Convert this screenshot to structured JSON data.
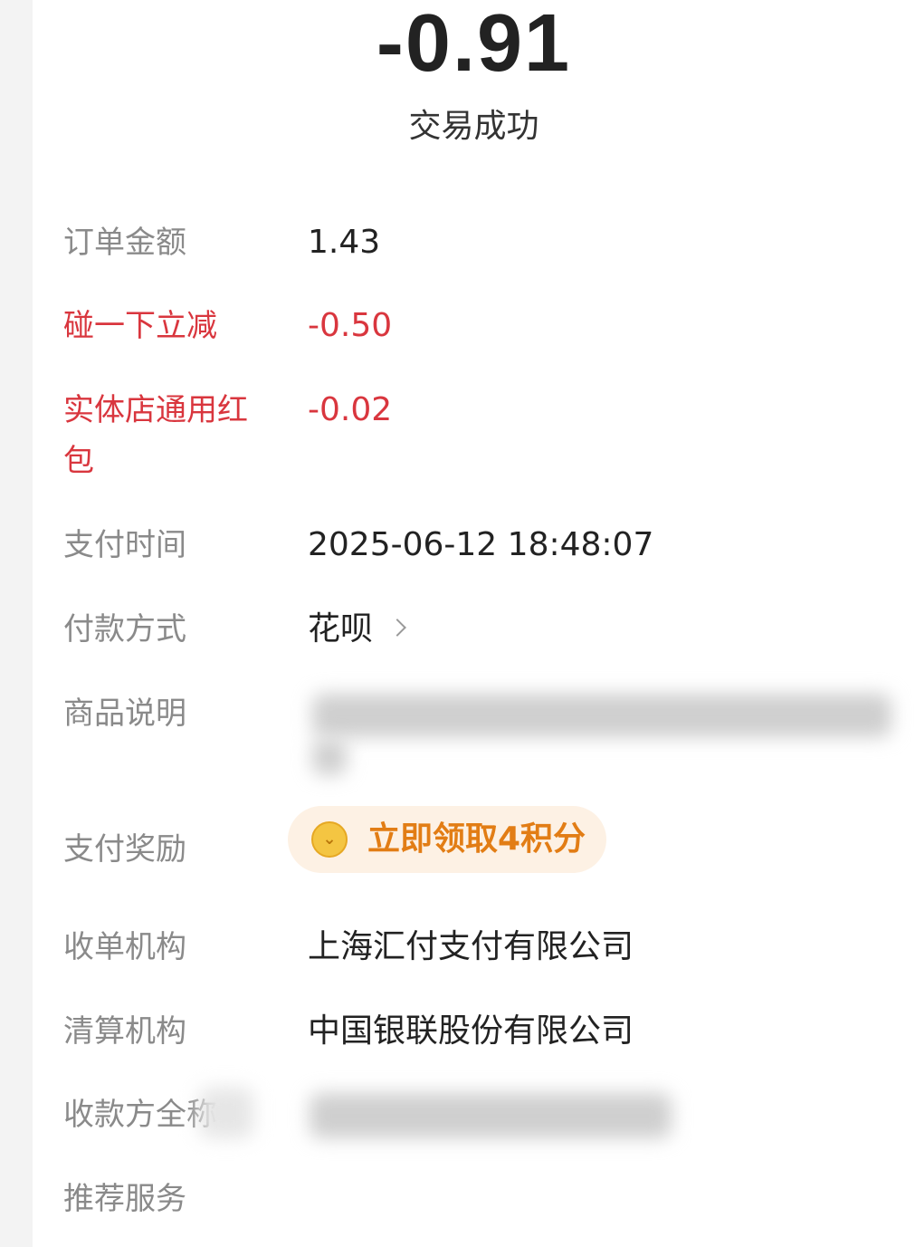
{
  "header": {
    "amount": "-0.91",
    "status": "交易成功"
  },
  "details": {
    "order_amount": {
      "label": "订单金额",
      "value": "1.43"
    },
    "tap_discount": {
      "label": "碰一下立减",
      "value": "-0.50"
    },
    "store_red_packet": {
      "label": "实体店通用红包",
      "value": "-0.02"
    },
    "pay_time": {
      "label": "支付时间",
      "value": "2025-06-12 18:48:07"
    },
    "pay_method": {
      "label": "付款方式",
      "value": "花呗",
      "icon": "chevron-right-icon"
    },
    "product_desc": {
      "label": "商品说明"
    },
    "pay_reward": {
      "label": "支付奖励",
      "button_label": "立即领取4积分",
      "icon": "coin-icon",
      "icon_glyph": "⌄"
    },
    "acquirer": {
      "label": "收单机构",
      "value": "上海汇付支付有限公司"
    },
    "clearing": {
      "label": "清算机构",
      "value": "中国银联股份有限公司"
    },
    "payee_name": {
      "label": "收款方全称"
    },
    "recommended": {
      "label": "推荐服务"
    }
  },
  "colors": {
    "discount_red": "#d9363e",
    "reward_orange": "#e27d15",
    "reward_bg": "#fdf1e4"
  }
}
